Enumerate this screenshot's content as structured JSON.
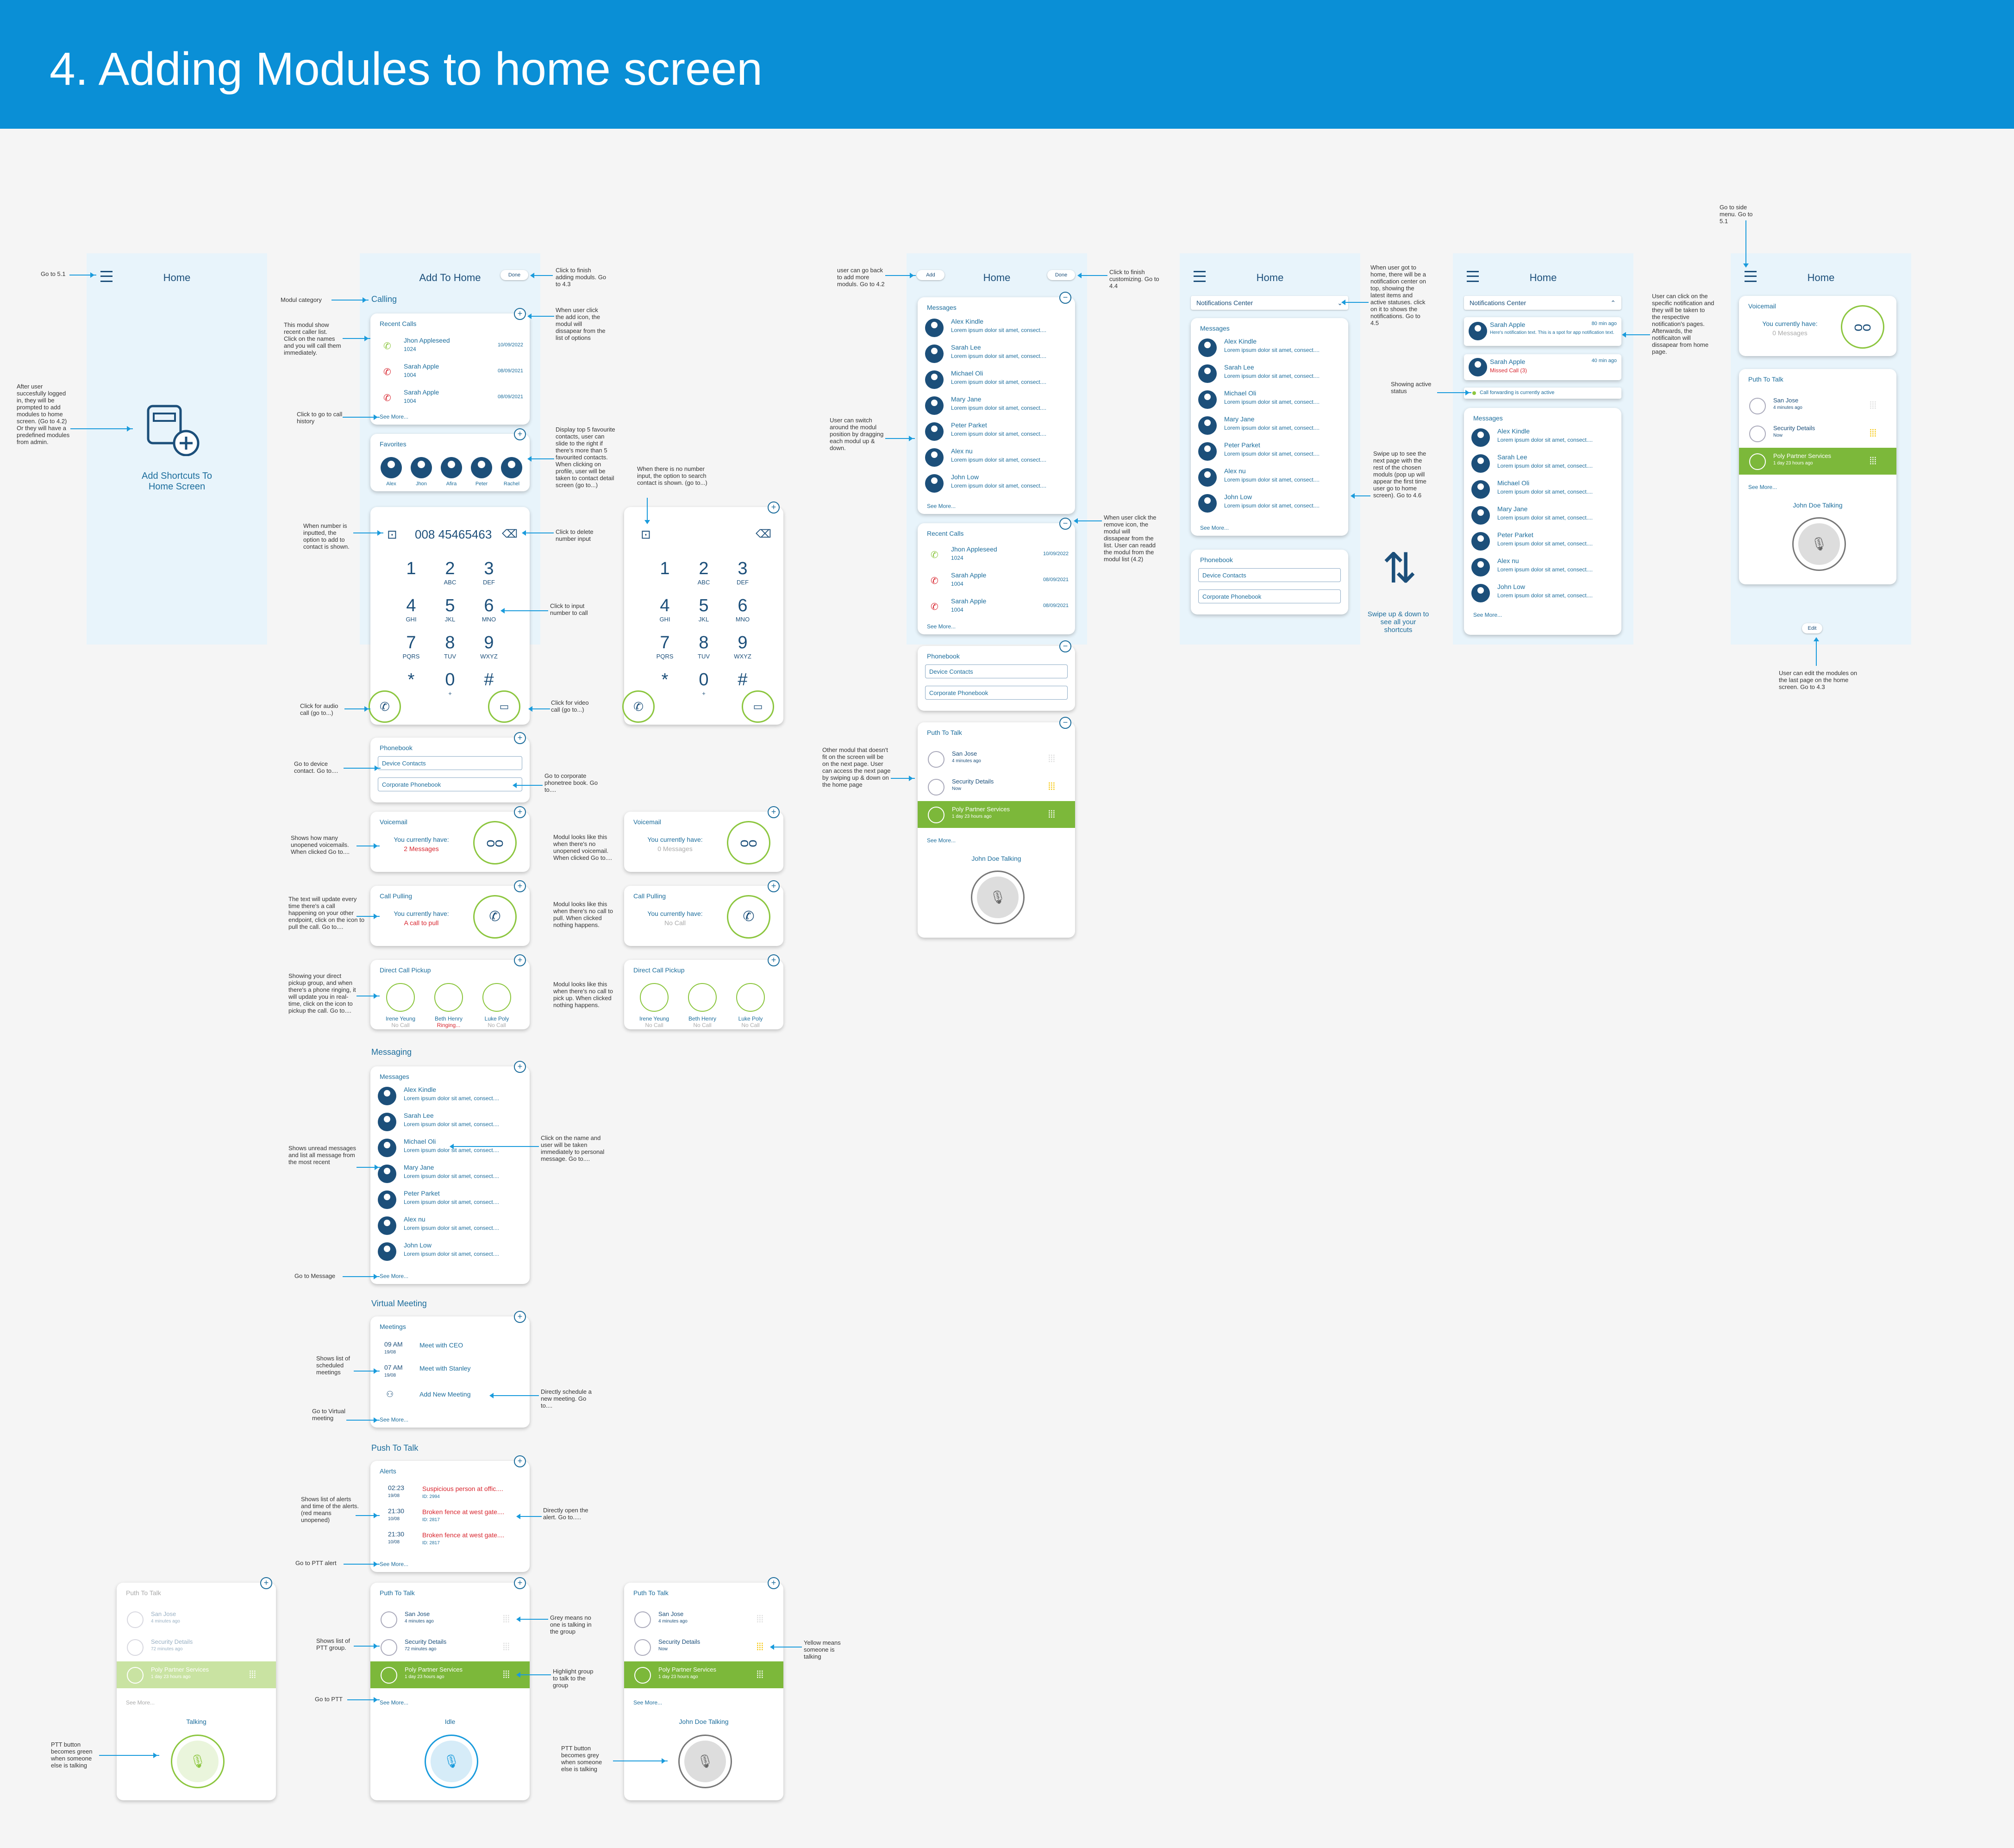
{
  "header": {
    "title": "4. Adding Modules to home screen"
  },
  "colors": {
    "header_bg": "#0a8fd6",
    "accent_green": "#8cc63f",
    "accent_yellow": "#f5c400",
    "navy": "#1c4f7a",
    "arrow": "#1a9bdc",
    "red": "#d8262f"
  },
  "screen1": {
    "title": "Home",
    "add_label": "Add Shortcuts To Home Screen",
    "note_goto": "Go to 5.1",
    "note_after": "After user succesfully logged in, they will be prompted to add modules to home screen. (Go to 4.2) Or they will have a predefined modules from admin."
  },
  "addscreen": {
    "title": "Add To Home",
    "done": "Done",
    "note_done": "Click to finish adding moduls. Go to 4.3",
    "note_category": "Modul category",
    "cat_calling": "Calling",
    "note_addicon": "When user click the add icon, the modul will dissapear from the list of options",
    "recent_title": "Recent Calls",
    "recent": [
      {
        "name": "Jhon Appleseed",
        "sub": "1024",
        "date": "10/09/2022"
      },
      {
        "name": "Sarah Apple",
        "sub": "1004",
        "date": "08/09/2021"
      },
      {
        "name": "Sarah Apple",
        "sub": "1004",
        "date": "08/09/2021"
      }
    ],
    "see_more": "See More...",
    "note_recent": "This modul show recent caller list. Click on the names and you will call them immediately.",
    "note_history": "Click to go to call history",
    "fav_title": "Favorites",
    "favs": [
      "Alex",
      "Jhon",
      "Afira",
      "Peter",
      "Rachel"
    ],
    "note_fav": "Display top 5 favourite contacts, user can slide to the right if there's more than 5 favourited contacts. When clicking on profile, user will be taken to contact detail screen (go to...)",
    "dial_number": "008 45465463",
    "note_dial": "When number is inputted, the option to add to contact is shown.",
    "note_delete": "Click to delete number input",
    "note_input": "Click to input number to call",
    "note_audio": "Click for audio call (go to...)",
    "note_video": "Click for video call (go to...)",
    "note_empty": "When there is no number input, the option to search contact is shown. (go to...)",
    "keys": [
      {
        "n": "1",
        "l": ""
      },
      {
        "n": "2",
        "l": "ABC"
      },
      {
        "n": "3",
        "l": "DEF"
      },
      {
        "n": "4",
        "l": "GHI"
      },
      {
        "n": "5",
        "l": "JKL"
      },
      {
        "n": "6",
        "l": "MNO"
      },
      {
        "n": "7",
        "l": "PQRS"
      },
      {
        "n": "8",
        "l": "TUV"
      },
      {
        "n": "9",
        "l": "WXYZ"
      },
      {
        "n": "*",
        "l": ""
      },
      {
        "n": "0",
        "l": "+"
      },
      {
        "n": "#",
        "l": ""
      }
    ],
    "pb_title": "Phonebook",
    "pb_device": "Device Contacts",
    "pb_corporate": "Corporate Phonebook",
    "note_device": "Go to device contact. Go to....",
    "note_corp": "Go to corporate phonetree book. Go to....",
    "vm_title": "Voicemail",
    "vm_have": "You currently have:",
    "vm_count": "2 Messages",
    "vm_zero": "0 Messages",
    "note_vm": "Shows how many unopened voicemails. When clicked Go to....",
    "note_vm0": "Modul looks like this when there's no unopened voicemail. When clicked Go to....",
    "cp_title": "Call Pulling",
    "cp_call": "A call to pull",
    "cp_none": "No Call",
    "note_cp": "The text will update every time there's a call happening on your other endpoint, click on the icon to pull the call. Go to....",
    "note_cp0": "Modul looks like this when there's no call to pull. When clicked nothing happens.",
    "dcp_title": "Direct Call Pickup",
    "dcp": [
      {
        "name": "Irene Yeung",
        "status": "No Call"
      },
      {
        "name": "Beth Henry",
        "status": "Ringing..."
      },
      {
        "name": "Luke Poly",
        "status": "No Call"
      }
    ],
    "dcp0_status": "No Call",
    "note_dcp": "Showing your direct pickup group, and when there's a phone ringing, it will update you in real-time, click on the icon to pickup the call. Go to....",
    "note_dcp0": "Modul looks like this when there's no call to pick up. When clicked nothing happens.",
    "cat_messaging": "Messaging",
    "msg_title": "Messages",
    "msgs": [
      {
        "name": "Alex Kindle",
        "text": "Lorem ipsum dolor sit amet, consect...."
      },
      {
        "name": "Sarah Lee",
        "text": "Lorem ipsum dolor sit amet, consect...."
      },
      {
        "name": "Michael Oli",
        "text": "Lorem ipsum dolor sit amet, consect...."
      },
      {
        "name": "Mary Jane",
        "text": "Lorem ipsum dolor sit amet, consect...."
      },
      {
        "name": "Peter Parket",
        "text": "Lorem ipsum dolor sit amet, consect...."
      },
      {
        "name": "Alex nu",
        "text": "Lorem ipsum dolor sit amet, consect...."
      },
      {
        "name": "John Low",
        "text": "Lorem ipsum dolor sit amet, consect...."
      }
    ],
    "note_msgs": "Shows unread messages and list all message from the most recent",
    "note_msgname": "Click on the name and user will be taken immediately to personal message. Go to....",
    "note_gomsg": "Go to Message",
    "cat_vm": "Virtual Meeting",
    "meet_title": "Meetings",
    "meets": [
      {
        "time": "09 AM",
        "date": "19/08",
        "name": "Meet with CEO"
      },
      {
        "time": "07 AM",
        "date": "19/08",
        "name": "Meet with Stanley"
      }
    ],
    "meet_add": "Add New Meeting",
    "note_meet": "Shows list of scheduled meetings",
    "note_sched": "Directly schedule a new meeting. Go to....",
    "note_gomeet": "Go to Virtual meeting",
    "cat_ptt": "Push To Talk",
    "alerts_title": "Alerts",
    "alerts": [
      {
        "time": "02:23",
        "date": "19/08",
        "name": "Suspicious person at offic....",
        "id": "ID: 2994"
      },
      {
        "time": "21:30",
        "date": "10/08",
        "name": "Broken fence at west gate....",
        "id": "ID: 2817"
      },
      {
        "time": "21:30",
        "date": "10/08",
        "name": "Broken fence at west gate....",
        "id": "ID: 2817"
      }
    ],
    "note_alerts": "Shows list of alerts and time of the alerts. (red means unopened)",
    "note_alert_open": "Directly open the alert. Go to.....",
    "note_goalert": "Go to PTT alert"
  },
  "ptt": {
    "title": "Puth To Talk",
    "groups": [
      {
        "name": "San Jose",
        "sub": "4 minutes ago"
      },
      {
        "name": "Security Details",
        "sub": "72 minutes ago"
      },
      {
        "name": "Poly Partner Services",
        "sub": "1 day 23 hours ago"
      }
    ],
    "groups_b": [
      {
        "name": "San Jose",
        "sub": "4 minutes ago"
      },
      {
        "name": "Security Details",
        "sub": "Now"
      },
      {
        "name": "Poly Partner Services",
        "sub": "1 day 23 hours ago"
      }
    ],
    "see_more": "See More...",
    "talking": "Talking",
    "idle": "Idle",
    "john": "John Doe Talking",
    "note_grey": "Grey means no one is talking in the group",
    "note_list": "Shows list of PTT group.",
    "note_highlight": "Highlight group to talk to the group",
    "note_goptt": "Go to PTT",
    "note_green": "PTT button becomes green when someone else is talking",
    "note_greybtn": "PTT button becomes grey when someone else is talking",
    "note_yellow": "Yellow means someone is talking"
  },
  "home2": {
    "title": "Home",
    "add": "Add",
    "done": "Done",
    "note_add": "user can go back to add more moduls. Go to 4.2",
    "note_done": "Click to finish customizing. Go to 4.4",
    "note_drag": "User can switch around the modul position by dragging each modul up & down.",
    "note_remove": "When user click the remove icon, the modul will dissapear from the list. User can readd the modul from the modul list (4.2)",
    "note_other": "Other modul that doesn't fit on the screen will be on the next page. User can access the next page by swiping up & down on the home page",
    "msgs_title": "Messages",
    "recent_title": "Recent Calls",
    "pb_title": "Phonebook",
    "ptt_title": "Puth To Talk"
  },
  "home3": {
    "title": "Home",
    "notif": "Notifications Center",
    "note_notif": "When user got to home, there will be a notification center on top, showing the latest items and active statuses. click on it to shows the notifications. Go to 4.5",
    "note_swipe": "Swipe up to see the next page with the rest of the chosen moduls (pop up will appear the first time user go to home screen). Go to 4.6",
    "swipe_label": "Swipe up & down to see all your shortcuts"
  },
  "home4": {
    "title": "Home",
    "notif": "Notifications Center",
    "n1_name": "Sarah Apple",
    "n1_time": "80 min ago",
    "n1_text": "Here's notification text. This is a spot for app notification text.",
    "n2_name": "Sarah Apple",
    "n2_time": "40 min ago",
    "n2_text": "Missed Call (3)",
    "status": "Call forwarding is currently active",
    "note_click": "User can click on the specific notification and they will be taken to the respective notification's pages. Afterwards, the notificaiton will dissapear from home page.",
    "note_status": "Showing active status"
  },
  "home5": {
    "title": "Home",
    "note_side": "Go to side menu. Go to 5.1",
    "edit": "Edit",
    "note_edit": "User can edit the modules on the last page on the home screen. Go to 4.3"
  }
}
